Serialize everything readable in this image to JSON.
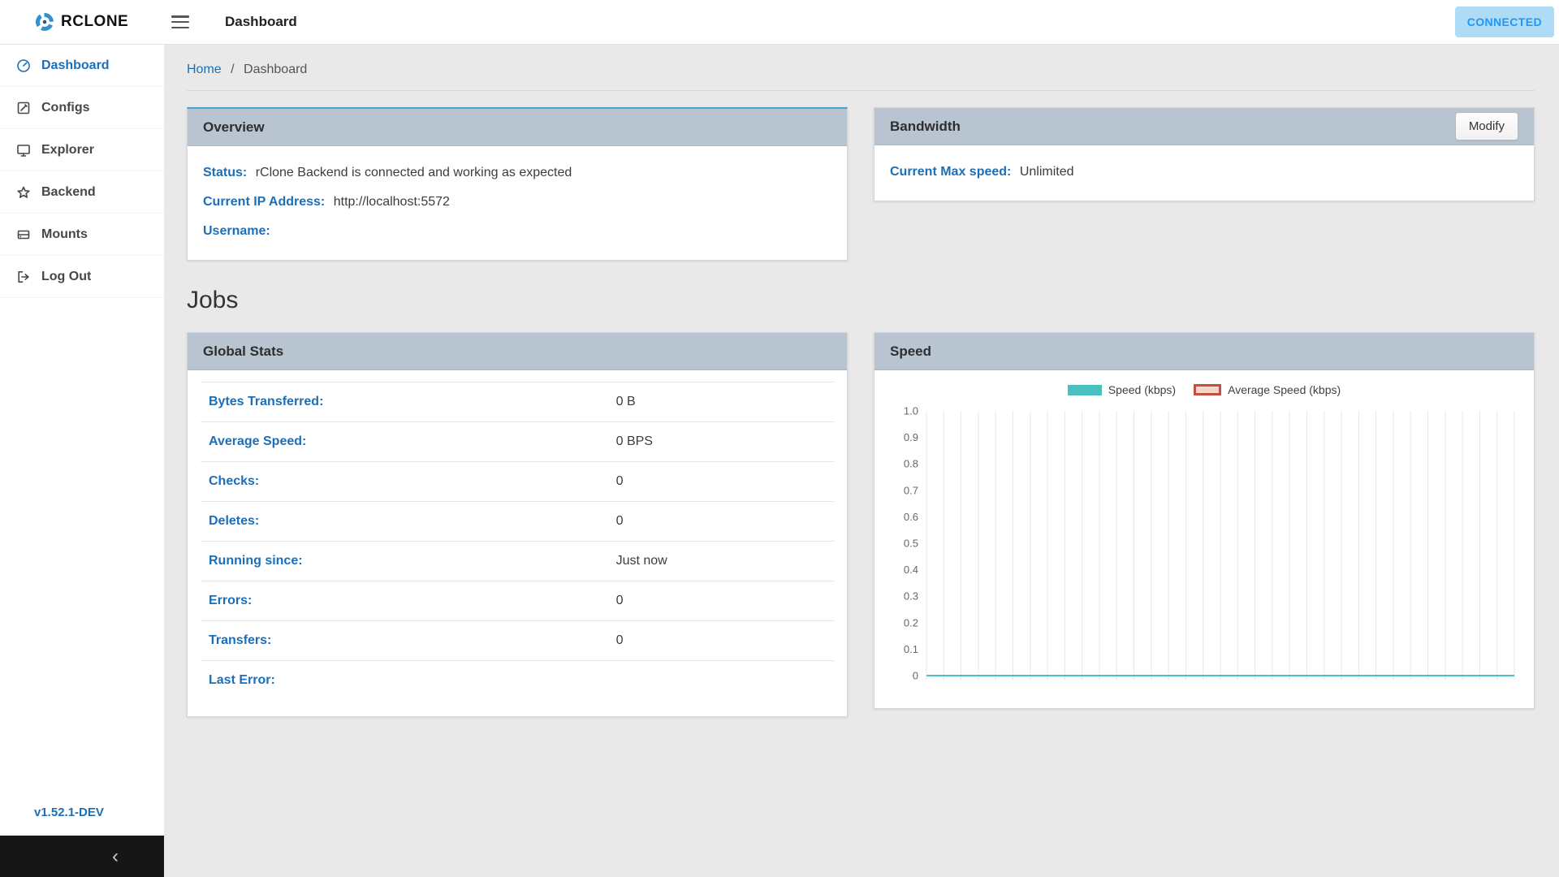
{
  "header": {
    "app_name": "RCLONE",
    "title": "Dashboard",
    "connected_label": "CONNECTED"
  },
  "sidebar": {
    "items": [
      {
        "label": "Dashboard",
        "active": true
      },
      {
        "label": "Configs",
        "active": false
      },
      {
        "label": "Explorer",
        "active": false
      },
      {
        "label": "Backend",
        "active": false
      },
      {
        "label": "Mounts",
        "active": false
      },
      {
        "label": "Log Out",
        "active": false
      }
    ],
    "version": "v1.52.1-DEV",
    "collapse_chevron": "‹"
  },
  "breadcrumb": {
    "home": "Home",
    "separator": "/",
    "current": "Dashboard"
  },
  "overview": {
    "title": "Overview",
    "rows": [
      {
        "label": "Status:",
        "value": "rClone Backend is connected and working as expected"
      },
      {
        "label": "Current IP Address:",
        "value": "http://localhost:5572"
      },
      {
        "label": "Username:",
        "value": ""
      }
    ]
  },
  "bandwidth": {
    "title": "Bandwidth",
    "modify_label": "Modify",
    "label": "Current Max speed:",
    "value": "Unlimited"
  },
  "jobs": {
    "heading": "Jobs"
  },
  "global_stats": {
    "title": "Global Stats",
    "rows": [
      {
        "label": "Bytes Transferred:",
        "value": "0 B"
      },
      {
        "label": "Average Speed:",
        "value": "0 BPS"
      },
      {
        "label": "Checks:",
        "value": "0"
      },
      {
        "label": "Deletes:",
        "value": "0"
      },
      {
        "label": "Running since:",
        "value": "Just now"
      },
      {
        "label": "Errors:",
        "value": "0"
      },
      {
        "label": "Transfers:",
        "value": "0"
      },
      {
        "label": "Last Error:",
        "value": ""
      }
    ]
  },
  "speed_card": {
    "title": "Speed"
  },
  "chart_data": {
    "type": "line",
    "title": "Speed",
    "xlabel": "",
    "ylabel": "",
    "ylim": [
      0,
      1
    ],
    "yticks": [
      "0",
      "0.1",
      "0.2",
      "0.3",
      "0.4",
      "0.5",
      "0.6",
      "0.7",
      "0.8",
      "0.9",
      "1.0"
    ],
    "x_gridlines": 35,
    "grid": "vertical-only",
    "legend_position": "top-center",
    "series": [
      {
        "name": "Speed (kbps)",
        "color": "#4bc0c0",
        "values": [
          0,
          0,
          0,
          0,
          0,
          0,
          0,
          0,
          0,
          0,
          0,
          0,
          0,
          0,
          0,
          0,
          0,
          0,
          0,
          0,
          0,
          0,
          0,
          0,
          0,
          0,
          0,
          0,
          0,
          0,
          0,
          0,
          0,
          0,
          0
        ]
      },
      {
        "name": "Average Speed (kbps)",
        "color": "#c0513d",
        "fill": "#f6d5cc",
        "values": [
          0,
          0,
          0,
          0,
          0,
          0,
          0,
          0,
          0,
          0,
          0,
          0,
          0,
          0,
          0,
          0,
          0,
          0,
          0,
          0,
          0,
          0,
          0,
          0,
          0,
          0,
          0,
          0,
          0,
          0,
          0,
          0,
          0,
          0,
          0
        ]
      }
    ]
  },
  "colors": {
    "accent_blue": "#1b6fb8",
    "connected_bg": "#aedcf7",
    "connected_text": "#2196f3",
    "card_header_bg": "#b8c5d0",
    "overview_top_border": "#45a1d8",
    "speed_line": "#4bc0c0",
    "avg_border": "#c0513d",
    "avg_fill": "#f6d5cc",
    "sidebar_collapse_bg": "#161616"
  }
}
